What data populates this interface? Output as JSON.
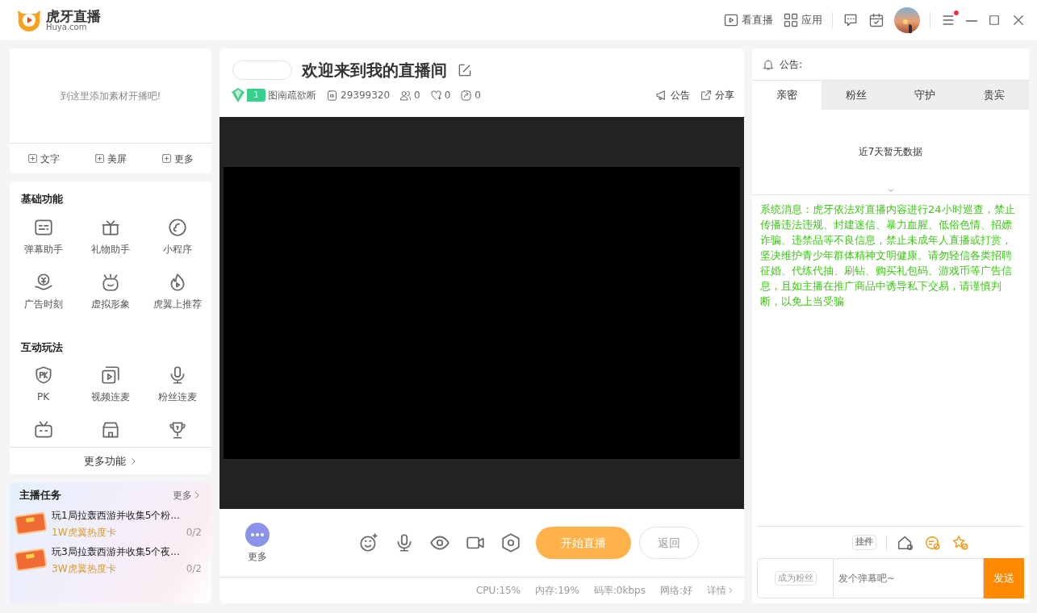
{
  "app": {
    "logo_name": "虎牙直播",
    "logo_domain": "Huya.com"
  },
  "top_nav": [
    {
      "kind": "play",
      "label": "看直播"
    },
    {
      "kind": "apps",
      "label": "应用"
    }
  ],
  "notifications": {
    "menu_badge": true
  },
  "material_panel": {
    "hint": "到这里添加素材开播吧!",
    "actions": [
      "文字",
      "美屏",
      "更多"
    ]
  },
  "feature_groups": [
    {
      "title": "基础功能",
      "items": [
        {
          "kind": "danmaku",
          "label": "弹幕助手"
        },
        {
          "kind": "gift",
          "label": "礼物助手"
        },
        {
          "kind": "miniapp",
          "label": "小程序"
        },
        {
          "kind": "ad",
          "label": "广告时刻"
        },
        {
          "kind": "avatar",
          "label": "虚拟形象"
        },
        {
          "kind": "fire",
          "label": "虎翼上推荐"
        }
      ]
    },
    {
      "title": "互动玩法",
      "items": [
        {
          "kind": "pk",
          "label": "PK"
        },
        {
          "kind": "video",
          "label": "视频连麦"
        },
        {
          "kind": "mic",
          "label": "粉丝连麦"
        },
        {
          "kind": "tv"
        },
        {
          "kind": "shop"
        },
        {
          "kind": "trophy"
        }
      ]
    }
  ],
  "more_features": "更多功能",
  "tasks": {
    "title": "主播任务",
    "more": "更多",
    "items": [
      {
        "name": "玩1局拉轰西游并收集5个粉...",
        "reward": "1W虎翼热度卡",
        "progress": "0/2",
        "completed": false
      },
      {
        "name": "玩3局拉轰西游并收集5个夜...",
        "reward": "3W虎翼热度卡",
        "progress": "0/2",
        "completed": false
      }
    ]
  },
  "room": {
    "title": "欢迎来到我的直播间",
    "level": "1",
    "owner": "图南疏欲断",
    "room_id": "29399320",
    "stats": [
      {
        "kind": "fans",
        "value": "0"
      },
      {
        "kind": "likes",
        "value": "0"
      },
      {
        "kind": "shares",
        "value": "0"
      }
    ],
    "actions": [
      {
        "kind": "notice",
        "label": "公告"
      },
      {
        "kind": "share",
        "label": "分享"
      }
    ]
  },
  "controls": {
    "more": "更多",
    "tools": [
      {
        "kind": "emoji"
      },
      {
        "kind": "mic"
      },
      {
        "kind": "eye"
      },
      {
        "kind": "camera"
      },
      {
        "kind": "settings"
      }
    ],
    "start": "开始直播",
    "back": "返回"
  },
  "status_bar": [
    "CPU:15%",
    "内存:19%",
    "码率:0kbps",
    "网络:好",
    "详情"
  ],
  "announcement": {
    "label": "公告:"
  },
  "rank_tabs": [
    {
      "label": "亲密",
      "selected": true
    },
    {
      "label": "粉丝",
      "selected": false
    },
    {
      "label": "守护",
      "selected": false
    },
    {
      "label": "贵宾",
      "selected": false
    }
  ],
  "rank_empty": "近7天暂无数据",
  "system_message": "系统消息：虎牙依法对直播内容进行24小时巡查，禁止传播违法违规、封建迷信、暴力血腥、低俗色情、招嫖诈骗、违禁品等不良信息，禁止未成年人直播或打赏，坚决维护青少年群体精神文明健康。请勿轻信各类招聘征婚、代练代抽、刷钻、购买礼包码、游戏币等广告信息，且如主播在推广商品中诱导私下交易，请谨慎判断，以免上当受骗",
  "chat_tools": {
    "widget": "挂件"
  },
  "chat_input": {
    "fan_button": "成为粉丝",
    "placeholder": "发个弹幕吧~",
    "send": "发送"
  }
}
